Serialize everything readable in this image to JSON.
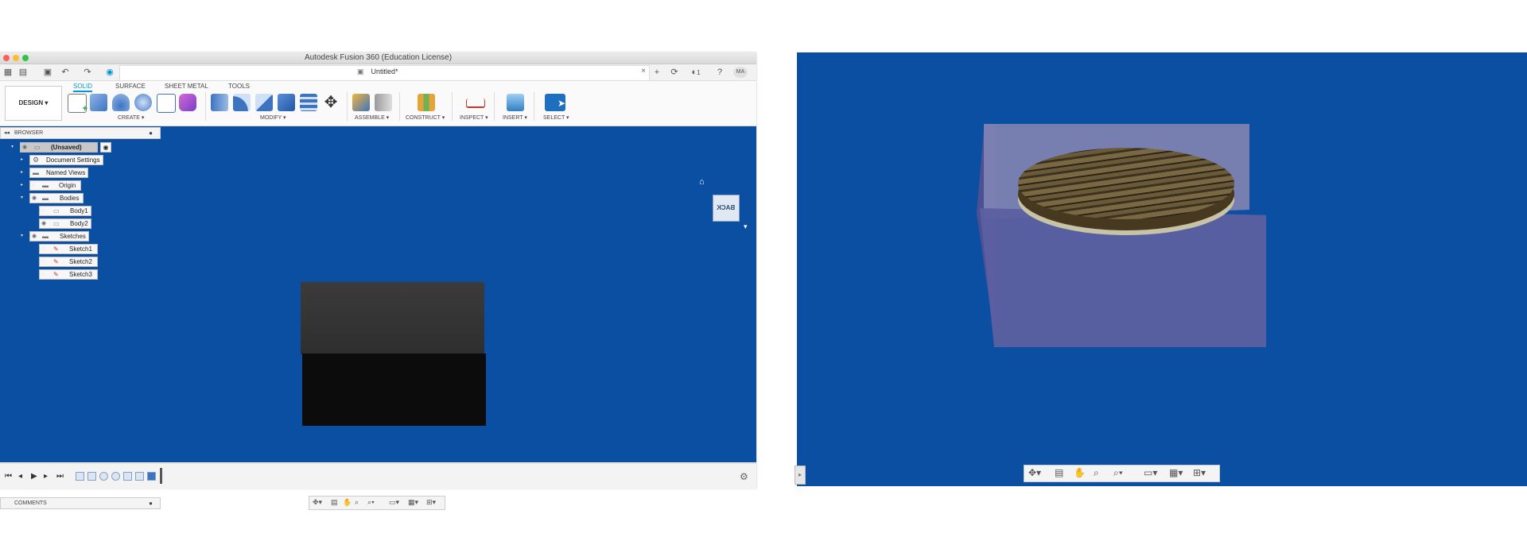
{
  "window": {
    "title": "Autodesk Fusion 360 (Education License)",
    "doc_tab": "Untitled*",
    "job_count": "1",
    "user_initials": "MA"
  },
  "ribbon": {
    "workspace": "DESIGN ▾",
    "tabs": [
      "SOLID",
      "SURFACE",
      "SHEET METAL",
      "TOOLS"
    ],
    "groups": {
      "create": "CREATE ▾",
      "modify": "MODIFY ▾",
      "assemble": "ASSEMBLE ▾",
      "construct": "CONSTRUCT ▾",
      "inspect": "INSPECT ▾",
      "insert": "INSERT ▾",
      "select": "SELECT ▾"
    }
  },
  "browser": {
    "header": "BROWSER",
    "items": [
      {
        "label": "(Unsaved)"
      },
      {
        "label": "Document Settings"
      },
      {
        "label": "Named Views"
      },
      {
        "label": "Origin"
      },
      {
        "label": "Bodies"
      },
      {
        "label": "Body1"
      },
      {
        "label": "Body2"
      },
      {
        "label": "Sketches"
      },
      {
        "label": "Sketch1"
      },
      {
        "label": "Sketch2"
      },
      {
        "label": "Sketch3"
      }
    ]
  },
  "viewcube": {
    "label": "BACK"
  },
  "comments": {
    "header": "COMMENTS"
  },
  "colors": {
    "viewport_bg": "#0a4fa2",
    "accent": "#0696d7",
    "close": "#ff5f57",
    "minimize": "#febc2e",
    "zoom": "#28c840"
  }
}
